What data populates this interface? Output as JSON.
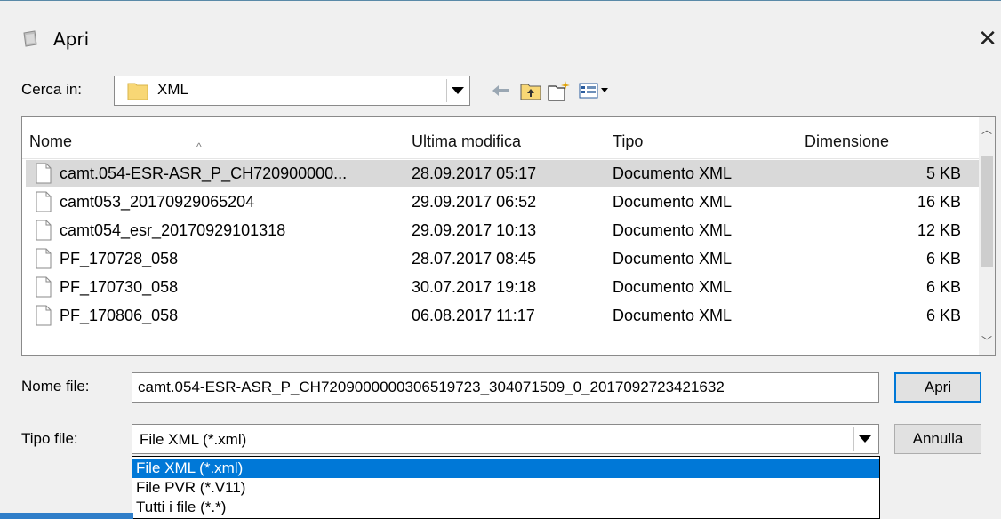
{
  "window": {
    "title": "Apri",
    "close_glyph": "✕"
  },
  "toolbar": {
    "look_in_label": "Cerca in:",
    "look_in_value": "XML",
    "icons": [
      "back-arrow-icon",
      "up-folder-icon",
      "new-folder-icon",
      "view-menu-icon"
    ]
  },
  "list": {
    "columns": [
      "Nome",
      "Ultima modifica",
      "Tipo",
      "Dimensione"
    ],
    "sort_indicator": "^",
    "rows": [
      {
        "name": "camt.054-ESR-ASR_P_CH720900000...",
        "modified": "28.09.2017 05:17",
        "type": "Documento XML",
        "size": "5 KB"
      },
      {
        "name": "camt053_20170929065204",
        "modified": "29.09.2017 06:52",
        "type": "Documento XML",
        "size": "16 KB"
      },
      {
        "name": "camt054_esr_20170929101318",
        "modified": "29.09.2017 10:13",
        "type": "Documento XML",
        "size": "12 KB"
      },
      {
        "name": "PF_170728_058",
        "modified": "28.07.2017 08:45",
        "type": "Documento XML",
        "size": "6 KB"
      },
      {
        "name": "PF_170730_058",
        "modified": "30.07.2017 19:18",
        "type": "Documento XML",
        "size": "6 KB"
      },
      {
        "name": "PF_170806_058",
        "modified": "06.08.2017 11:17",
        "type": "Documento XML",
        "size": "6 KB"
      }
    ],
    "selected_index": 0
  },
  "form": {
    "filename_label": "Nome file:",
    "filename_value": "camt.054-ESR-ASR_P_CH7209000000306519723_304071509_0_2017092723421632",
    "filetype_label": "Tipo file:",
    "filetype_value": "File XML (*.xml)",
    "open_button": "Apri",
    "cancel_button": "Annulla",
    "filetype_options": [
      "File XML (*.xml)",
      "File PVR (*.V11)",
      "Tutti i file (*.*)"
    ]
  },
  "colors": {
    "accent": "#0078d7",
    "selected_row": "#d9d9d9",
    "folder": "#f8d775"
  }
}
